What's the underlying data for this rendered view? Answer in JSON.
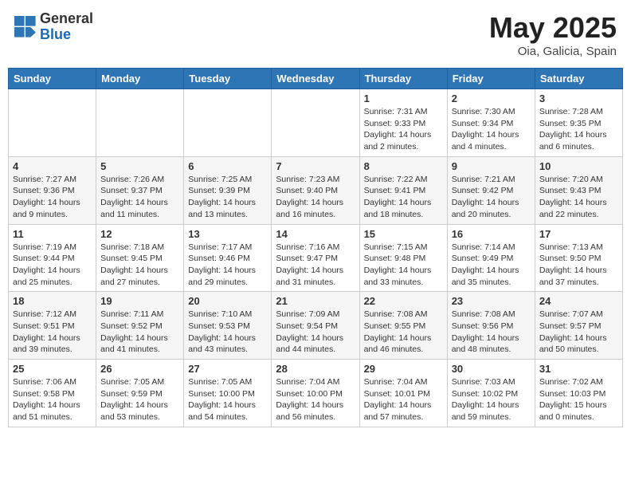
{
  "header": {
    "logo_general": "General",
    "logo_blue": "Blue",
    "month_year": "May 2025",
    "location": "Oia, Galicia, Spain"
  },
  "days_of_week": [
    "Sunday",
    "Monday",
    "Tuesday",
    "Wednesday",
    "Thursday",
    "Friday",
    "Saturday"
  ],
  "weeks": [
    [
      {
        "day": "",
        "info": ""
      },
      {
        "day": "",
        "info": ""
      },
      {
        "day": "",
        "info": ""
      },
      {
        "day": "",
        "info": ""
      },
      {
        "day": "1",
        "info": "Sunrise: 7:31 AM\nSunset: 9:33 PM\nDaylight: 14 hours\nand 2 minutes."
      },
      {
        "day": "2",
        "info": "Sunrise: 7:30 AM\nSunset: 9:34 PM\nDaylight: 14 hours\nand 4 minutes."
      },
      {
        "day": "3",
        "info": "Sunrise: 7:28 AM\nSunset: 9:35 PM\nDaylight: 14 hours\nand 6 minutes."
      }
    ],
    [
      {
        "day": "4",
        "info": "Sunrise: 7:27 AM\nSunset: 9:36 PM\nDaylight: 14 hours\nand 9 minutes."
      },
      {
        "day": "5",
        "info": "Sunrise: 7:26 AM\nSunset: 9:37 PM\nDaylight: 14 hours\nand 11 minutes."
      },
      {
        "day": "6",
        "info": "Sunrise: 7:25 AM\nSunset: 9:39 PM\nDaylight: 14 hours\nand 13 minutes."
      },
      {
        "day": "7",
        "info": "Sunrise: 7:23 AM\nSunset: 9:40 PM\nDaylight: 14 hours\nand 16 minutes."
      },
      {
        "day": "8",
        "info": "Sunrise: 7:22 AM\nSunset: 9:41 PM\nDaylight: 14 hours\nand 18 minutes."
      },
      {
        "day": "9",
        "info": "Sunrise: 7:21 AM\nSunset: 9:42 PM\nDaylight: 14 hours\nand 20 minutes."
      },
      {
        "day": "10",
        "info": "Sunrise: 7:20 AM\nSunset: 9:43 PM\nDaylight: 14 hours\nand 22 minutes."
      }
    ],
    [
      {
        "day": "11",
        "info": "Sunrise: 7:19 AM\nSunset: 9:44 PM\nDaylight: 14 hours\nand 25 minutes."
      },
      {
        "day": "12",
        "info": "Sunrise: 7:18 AM\nSunset: 9:45 PM\nDaylight: 14 hours\nand 27 minutes."
      },
      {
        "day": "13",
        "info": "Sunrise: 7:17 AM\nSunset: 9:46 PM\nDaylight: 14 hours\nand 29 minutes."
      },
      {
        "day": "14",
        "info": "Sunrise: 7:16 AM\nSunset: 9:47 PM\nDaylight: 14 hours\nand 31 minutes."
      },
      {
        "day": "15",
        "info": "Sunrise: 7:15 AM\nSunset: 9:48 PM\nDaylight: 14 hours\nand 33 minutes."
      },
      {
        "day": "16",
        "info": "Sunrise: 7:14 AM\nSunset: 9:49 PM\nDaylight: 14 hours\nand 35 minutes."
      },
      {
        "day": "17",
        "info": "Sunrise: 7:13 AM\nSunset: 9:50 PM\nDaylight: 14 hours\nand 37 minutes."
      }
    ],
    [
      {
        "day": "18",
        "info": "Sunrise: 7:12 AM\nSunset: 9:51 PM\nDaylight: 14 hours\nand 39 minutes."
      },
      {
        "day": "19",
        "info": "Sunrise: 7:11 AM\nSunset: 9:52 PM\nDaylight: 14 hours\nand 41 minutes."
      },
      {
        "day": "20",
        "info": "Sunrise: 7:10 AM\nSunset: 9:53 PM\nDaylight: 14 hours\nand 43 minutes."
      },
      {
        "day": "21",
        "info": "Sunrise: 7:09 AM\nSunset: 9:54 PM\nDaylight: 14 hours\nand 44 minutes."
      },
      {
        "day": "22",
        "info": "Sunrise: 7:08 AM\nSunset: 9:55 PM\nDaylight: 14 hours\nand 46 minutes."
      },
      {
        "day": "23",
        "info": "Sunrise: 7:08 AM\nSunset: 9:56 PM\nDaylight: 14 hours\nand 48 minutes."
      },
      {
        "day": "24",
        "info": "Sunrise: 7:07 AM\nSunset: 9:57 PM\nDaylight: 14 hours\nand 50 minutes."
      }
    ],
    [
      {
        "day": "25",
        "info": "Sunrise: 7:06 AM\nSunset: 9:58 PM\nDaylight: 14 hours\nand 51 minutes."
      },
      {
        "day": "26",
        "info": "Sunrise: 7:05 AM\nSunset: 9:59 PM\nDaylight: 14 hours\nand 53 minutes."
      },
      {
        "day": "27",
        "info": "Sunrise: 7:05 AM\nSunset: 10:00 PM\nDaylight: 14 hours\nand 54 minutes."
      },
      {
        "day": "28",
        "info": "Sunrise: 7:04 AM\nSunset: 10:00 PM\nDaylight: 14 hours\nand 56 minutes."
      },
      {
        "day": "29",
        "info": "Sunrise: 7:04 AM\nSunset: 10:01 PM\nDaylight: 14 hours\nand 57 minutes."
      },
      {
        "day": "30",
        "info": "Sunrise: 7:03 AM\nSunset: 10:02 PM\nDaylight: 14 hours\nand 59 minutes."
      },
      {
        "day": "31",
        "info": "Sunrise: 7:02 AM\nSunset: 10:03 PM\nDaylight: 15 hours\nand 0 minutes."
      }
    ]
  ]
}
